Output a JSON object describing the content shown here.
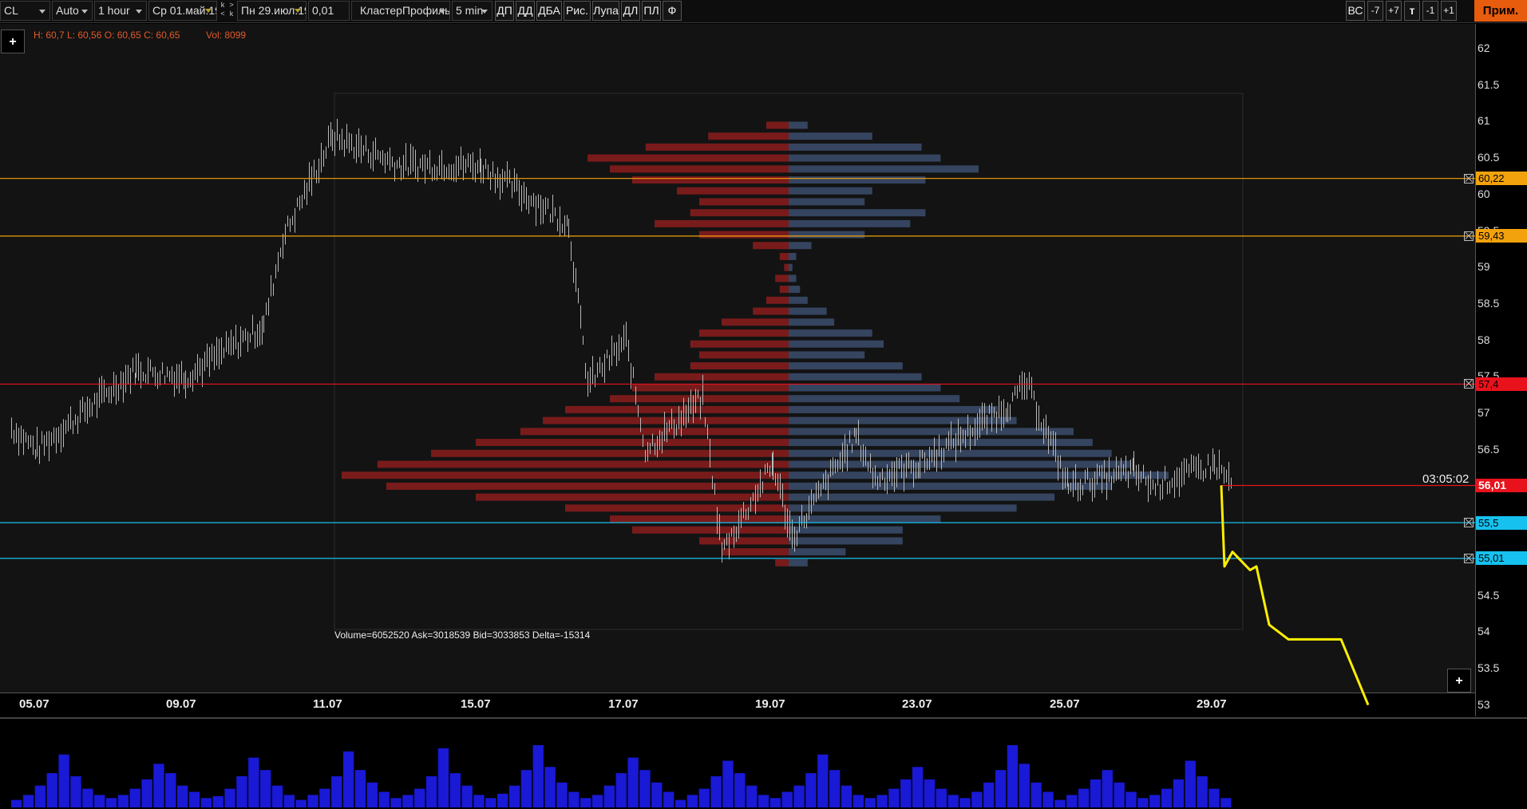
{
  "toolbar": {
    "symbol": "CL",
    "scale": "Auto",
    "period": "1 hour",
    "date_from": "Ср 01.май.19",
    "date_to": "Пн 29.июл.19",
    "tick_size": "0,01",
    "chart_type": "КластерПрофиль",
    "cluster_period": "5 min",
    "k_back": "k",
    "k_forward": "k",
    "arrow_left": "<",
    "arrow_right": ">",
    "tools": [
      "ДП",
      "ДД",
      "ДБА",
      "Рис.",
      "Лупа",
      "ДЛ",
      "ПЛ",
      "Ф"
    ],
    "right_buttons": [
      "ВС",
      "-7",
      "+7",
      "т",
      "-1",
      "+1"
    ],
    "apply_label": "Прим."
  },
  "legend": {
    "ohlc": "H: 60,7 L: 60,56 O: 60,65 C: 60,65",
    "volume": "Vol: 8099"
  },
  "profile_stats": "Volume=6052520  Ask=3018539  Bid=3033853  Delta=-15314",
  "timer": "03:05:02",
  "add_label": "+",
  "colors": {
    "orange_level": "#f2a20c",
    "red_level": "#e8121d",
    "blue_level": "#16c1ef",
    "bid_profile": "#8c1d1d",
    "ask_profile": "#3c4e6d",
    "volume_bars": "#1919d6",
    "forecast_line": "#ffef00"
  },
  "price_axis": {
    "labels": [
      "62",
      "61.5",
      "61",
      "60.5",
      "60",
      "59.5",
      "59",
      "58.5",
      "58",
      "57.5",
      "57",
      "56.5",
      "56",
      "55.5",
      "55",
      "54.5",
      "54",
      "53.5",
      "53"
    ],
    "min": 53,
    "max": 62
  },
  "date_axis": {
    "labels": [
      "05.07",
      "09.07",
      "11.07",
      "15.07",
      "17.07",
      "19.07",
      "23.07",
      "25.07",
      "29.07"
    ]
  },
  "levels": [
    {
      "price": 60.22,
      "label": "60,22",
      "kind": "orange"
    },
    {
      "price": 59.43,
      "label": "59,43",
      "kind": "orange"
    },
    {
      "price": 57.4,
      "label": "57,4",
      "kind": "red"
    },
    {
      "price": 56.01,
      "label": "56,01",
      "kind": "current"
    },
    {
      "price": 55.5,
      "label": "55,5",
      "kind": "blue"
    },
    {
      "price": 55.01,
      "label": "55,01",
      "kind": "blue"
    }
  ],
  "price_path": [
    {
      "date": "04.07",
      "price": 56.8
    },
    {
      "date": "05.07",
      "price": 56.5
    },
    {
      "date": "08.07",
      "price": 57.6
    },
    {
      "date": "09.07",
      "price": 57.5
    },
    {
      "date": "10.07",
      "price": 58.2
    },
    {
      "date": "10.07",
      "price": 59.4
    },
    {
      "date": "11.07",
      "price": 60.8
    },
    {
      "date": "12.07",
      "price": 60.4
    },
    {
      "date": "15.07",
      "price": 60.4
    },
    {
      "date": "16.07",
      "price": 59.6
    },
    {
      "date": "16.07",
      "price": 57.4
    },
    {
      "date": "17.07",
      "price": 58.0
    },
    {
      "date": "17.07",
      "price": 56.5
    },
    {
      "date": "18.07",
      "price": 57.2
    },
    {
      "date": "18.07",
      "price": 55.1
    },
    {
      "date": "19.07",
      "price": 56.3
    },
    {
      "date": "19.07",
      "price": 55.3
    },
    {
      "date": "22.07",
      "price": 56.7
    },
    {
      "date": "22.07",
      "price": 56.1
    },
    {
      "date": "23.07",
      "price": 56.3
    },
    {
      "date": "24.07",
      "price": 57.1
    },
    {
      "date": "24.07",
      "price": 57.4
    },
    {
      "date": "25.07",
      "price": 56.0
    },
    {
      "date": "26.07",
      "price": 56.2
    },
    {
      "date": "26.07",
      "price": 56.0
    },
    {
      "date": "29.07",
      "price": 56.3
    },
    {
      "date": "29.07",
      "price": 56.01
    }
  ],
  "forecast_path": [
    56.01,
    54.9,
    55.1,
    54.85,
    54.9,
    54.1,
    53.9,
    53.9,
    53.0
  ],
  "profile_rows": [
    {
      "price": 60.95,
      "bid": 0.05,
      "ask": 0.05
    },
    {
      "price": 60.8,
      "bid": 0.18,
      "ask": 0.22
    },
    {
      "price": 60.65,
      "bid": 0.32,
      "ask": 0.35
    },
    {
      "price": 60.5,
      "bid": 0.45,
      "ask": 0.4
    },
    {
      "price": 60.35,
      "bid": 0.4,
      "ask": 0.5
    },
    {
      "price": 60.2,
      "bid": 0.35,
      "ask": 0.36
    },
    {
      "price": 60.05,
      "bid": 0.25,
      "ask": 0.22
    },
    {
      "price": 59.9,
      "bid": 0.2,
      "ask": 0.2
    },
    {
      "price": 59.75,
      "bid": 0.22,
      "ask": 0.36
    },
    {
      "price": 59.6,
      "bid": 0.3,
      "ask": 0.32
    },
    {
      "price": 59.45,
      "bid": 0.2,
      "ask": 0.2
    },
    {
      "price": 59.3,
      "bid": 0.08,
      "ask": 0.06
    },
    {
      "price": 59.15,
      "bid": 0.02,
      "ask": 0.02
    },
    {
      "price": 59.0,
      "bid": 0.01,
      "ask": 0.01
    },
    {
      "price": 58.85,
      "bid": 0.03,
      "ask": 0.02
    },
    {
      "price": 58.7,
      "bid": 0.02,
      "ask": 0.03
    },
    {
      "price": 58.55,
      "bid": 0.05,
      "ask": 0.05
    },
    {
      "price": 58.4,
      "bid": 0.08,
      "ask": 0.1
    },
    {
      "price": 58.25,
      "bid": 0.15,
      "ask": 0.12
    },
    {
      "price": 58.1,
      "bid": 0.2,
      "ask": 0.22
    },
    {
      "price": 57.95,
      "bid": 0.22,
      "ask": 0.25
    },
    {
      "price": 57.8,
      "bid": 0.2,
      "ask": 0.2
    },
    {
      "price": 57.65,
      "bid": 0.22,
      "ask": 0.3
    },
    {
      "price": 57.5,
      "bid": 0.3,
      "ask": 0.35
    },
    {
      "price": 57.35,
      "bid": 0.35,
      "ask": 0.4
    },
    {
      "price": 57.2,
      "bid": 0.4,
      "ask": 0.45
    },
    {
      "price": 57.05,
      "bid": 0.5,
      "ask": 0.55
    },
    {
      "price": 56.9,
      "bid": 0.55,
      "ask": 0.6
    },
    {
      "price": 56.75,
      "bid": 0.6,
      "ask": 0.75
    },
    {
      "price": 56.6,
      "bid": 0.7,
      "ask": 0.8
    },
    {
      "price": 56.45,
      "bid": 0.8,
      "ask": 0.85
    },
    {
      "price": 56.3,
      "bid": 0.92,
      "ask": 0.9
    },
    {
      "price": 56.15,
      "bid": 1.0,
      "ask": 1.0
    },
    {
      "price": 56.0,
      "bid": 0.9,
      "ask": 0.85
    },
    {
      "price": 55.85,
      "bid": 0.7,
      "ask": 0.7
    },
    {
      "price": 55.7,
      "bid": 0.5,
      "ask": 0.6
    },
    {
      "price": 55.55,
      "bid": 0.4,
      "ask": 0.4
    },
    {
      "price": 55.4,
      "bid": 0.35,
      "ask": 0.3
    },
    {
      "price": 55.25,
      "bid": 0.2,
      "ask": 0.3
    },
    {
      "price": 55.1,
      "bid": 0.15,
      "ask": 0.15
    },
    {
      "price": 54.95,
      "bid": 0.03,
      "ask": 0.05
    }
  ],
  "volume_levels": [
    0.12,
    0.2,
    0.35,
    0.55,
    0.85,
    0.5,
    0.3,
    0.2,
    0.15,
    0.2,
    0.3,
    0.45,
    0.7,
    0.55,
    0.35,
    0.25,
    0.15,
    0.18,
    0.3,
    0.5,
    0.8,
    0.6,
    0.35,
    0.2,
    0.12,
    0.2,
    0.3,
    0.5,
    0.9,
    0.6,
    0.4,
    0.25,
    0.15,
    0.2,
    0.3,
    0.5,
    0.95,
    0.55,
    0.35,
    0.2,
    0.15,
    0.22,
    0.35,
    0.6,
    1.0,
    0.65,
    0.4,
    0.25,
    0.15,
    0.2,
    0.35,
    0.55,
    0.8,
    0.6,
    0.4,
    0.25,
    0.12,
    0.2,
    0.3,
    0.5,
    0.75,
    0.55,
    0.35,
    0.2,
    0.15,
    0.25,
    0.35,
    0.55,
    0.85,
    0.6,
    0.35,
    0.2,
    0.15,
    0.2,
    0.3,
    0.45,
    0.65,
    0.45,
    0.3,
    0.2,
    0.15,
    0.25,
    0.4,
    0.6,
    1.0,
    0.7,
    0.4,
    0.25,
    0.12,
    0.2,
    0.3,
    0.45,
    0.6,
    0.4,
    0.25,
    0.15,
    0.2,
    0.3,
    0.45,
    0.75,
    0.5,
    0.3,
    0.15
  ]
}
